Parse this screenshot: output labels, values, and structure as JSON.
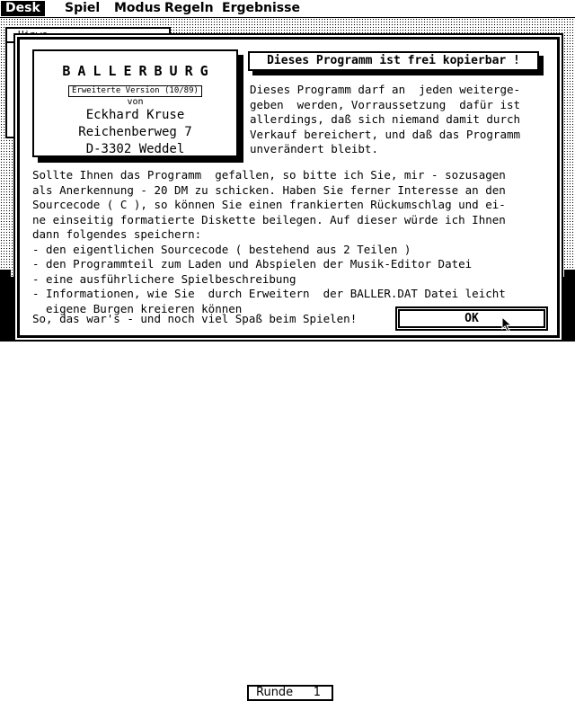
{
  "menubar": {
    "items": [
      "Desk",
      "Spiel",
      "Modus",
      "Regeln",
      "Ergebnisse"
    ],
    "active": "Desk"
  },
  "background_window": {
    "title": "Hinwe"
  },
  "dialog": {
    "author": {
      "title": "BALLERBURG",
      "version": "Erweiterte Version (10/89)",
      "von": "von",
      "name": "Eckhard Kruse",
      "street": "Reichenberweg 7",
      "city": "D-3302 Weddel"
    },
    "headline": "Dieses Programm ist frei kopierbar !",
    "right_text": "Dieses Programm darf an  jeden weiterge-\ngeben  werden, Vorraussetzung  dafür ist\nallerdings, daß sich niemand damit durch\nVerkauf bereichert, und daß das Programm\nunverändert bleibt.",
    "main_text": "Sollte Ihnen das Programm  gefallen, so bitte ich Sie, mir - sozusagen\nals Anerkennung - 20 DM zu schicken. Haben Sie ferner Interesse an den\nSourcecode ( C ), so können Sie einen frankierten Rückumschlag und ei-\nne einseitig formatierte Diskette beilegen. Auf dieser würde ich Ihnen\ndann folgendes speichern:\n- den eigentlichen Sourcecode ( bestehend aus 2 Teilen )\n- den Programmteil zum Laden und Abspielen der Musik-Editor Datei\n- eine ausführlichere Spielbeschreibung\n- Informationen, wie Sie  durch Erweitern  der BALLER.DAT Datei leicht\n  eigene Burgen kreieren können",
    "closing": "So, das war's - und noch viel Spaß beim Spielen!",
    "ok_label": "OK"
  },
  "status": {
    "round_label": "Runde",
    "round_value": "1"
  },
  "icons": [
    "mouse-pointer-icon"
  ]
}
